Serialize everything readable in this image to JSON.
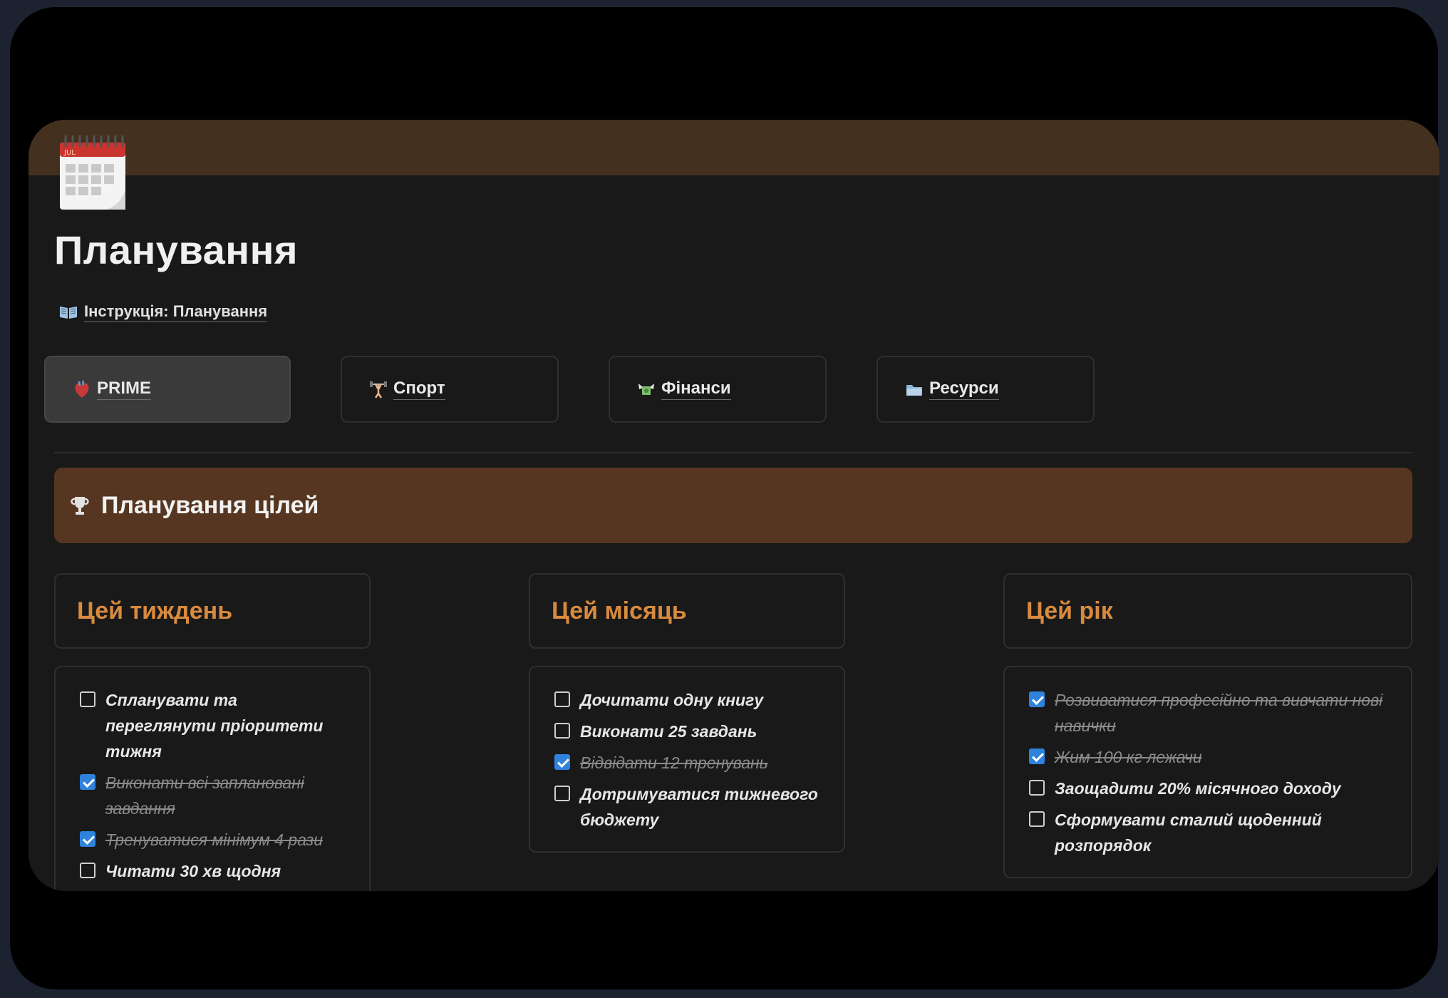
{
  "page": {
    "title": "Планування",
    "instruction_link": "Інструкція: Планування",
    "calendar_month": "JUL"
  },
  "nav": [
    {
      "label": "PRIME",
      "icon": "anatomical-heart-icon",
      "active": true
    },
    {
      "label": "Спорт",
      "icon": "weightlifter-icon",
      "active": false
    },
    {
      "label": "Фінанси",
      "icon": "money-wings-icon",
      "active": false
    },
    {
      "label": "Ресурси",
      "icon": "folder-icon",
      "active": false
    }
  ],
  "banner": {
    "title": "Планування цілей",
    "icon": "trophy-icon"
  },
  "columns": [
    {
      "heading": "Цей тиждень",
      "items": [
        {
          "text": "Спланувати та переглянути пріоритети тижня",
          "checked": false
        },
        {
          "text": "Виконати всі заплановані завдання",
          "checked": true
        },
        {
          "text": "Тренуватися мінімум 4 рази",
          "checked": true
        },
        {
          "text": "Читати 30 хв щодня",
          "checked": false
        }
      ]
    },
    {
      "heading": "Цей місяць",
      "items": [
        {
          "text": "Дочитати одну книгу",
          "checked": false
        },
        {
          "text": "Виконати 25 завдань",
          "checked": false
        },
        {
          "text": "Відвідати 12 тренувань",
          "checked": true
        },
        {
          "text": "Дотримуватися тижневого бюджету",
          "checked": false
        }
      ]
    },
    {
      "heading": "Цей рік",
      "items": [
        {
          "text": "Розвиватися професійно та вивчати нові навички",
          "checked": true
        },
        {
          "text": "Жим 100 кг лежачи",
          "checked": true
        },
        {
          "text": "Заощадити 20% місячного доходу",
          "checked": false
        },
        {
          "text": "Сформувати сталий щоденний розпорядок",
          "checked": false
        }
      ]
    }
  ],
  "colors": {
    "accent_heading": "#d88a3e",
    "banner": "#563620",
    "cover": "#43301f",
    "checkbox_checked": "#2f83dd"
  }
}
